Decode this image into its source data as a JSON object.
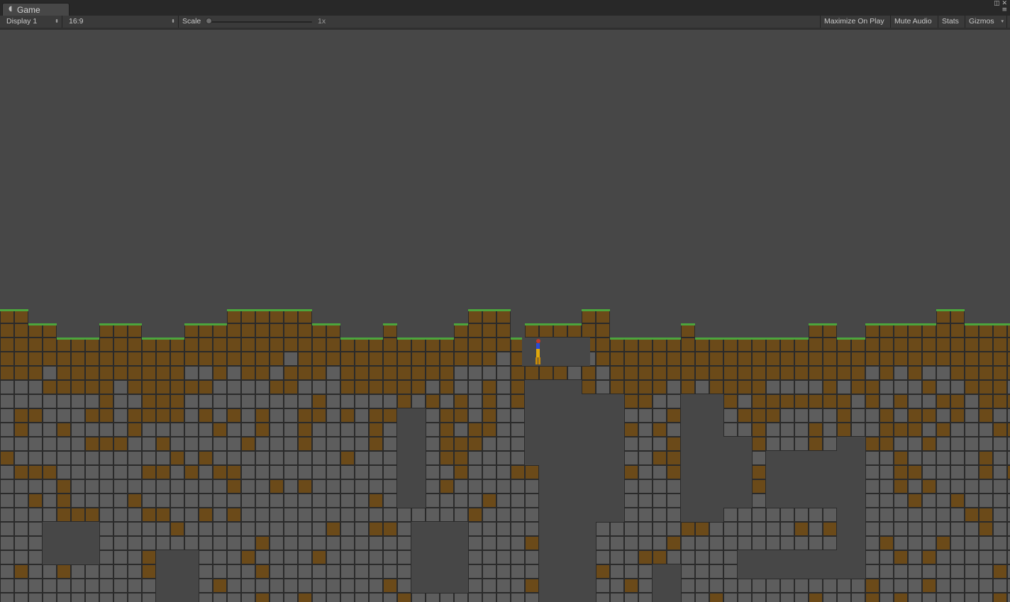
{
  "tab": {
    "label": "Game",
    "icon": "pacman-icon"
  },
  "window_buttons": {
    "maximize": "◫",
    "close": "✕",
    "menu": "≡"
  },
  "toolbar": {
    "display": "Display 1",
    "aspect": "16:9",
    "scale_label": "Scale",
    "scale_value": "1x",
    "maximize_on_play": "Maximize On Play",
    "mute_audio": "Mute Audio",
    "stats": "Stats",
    "gizmos": "Gizmos"
  },
  "colors": {
    "sky": "#474747",
    "dirt": "#6b4a19",
    "stone": "#5d5d5d",
    "grass": "#4ca53d",
    "grid": "#2a2a2a"
  },
  "level": {
    "columns": 72,
    "surface_rows": [
      0,
      0,
      1,
      1,
      2,
      2,
      2,
      1,
      1,
      1,
      2,
      2,
      2,
      1,
      1,
      1,
      0,
      0,
      0,
      0,
      0,
      0,
      1,
      1,
      2,
      2,
      2,
      1,
      2,
      2,
      2,
      2,
      1,
      0,
      0,
      0,
      2,
      1,
      1,
      1,
      1,
      0,
      0,
      2,
      2,
      2,
      2,
      2,
      1,
      2,
      2,
      2,
      2,
      2,
      2,
      2,
      2,
      1,
      1,
      2,
      2,
      1,
      1,
      1,
      1,
      1,
      0,
      0,
      1,
      1,
      1,
      1
    ]
  },
  "player": {
    "name": "player-character"
  }
}
